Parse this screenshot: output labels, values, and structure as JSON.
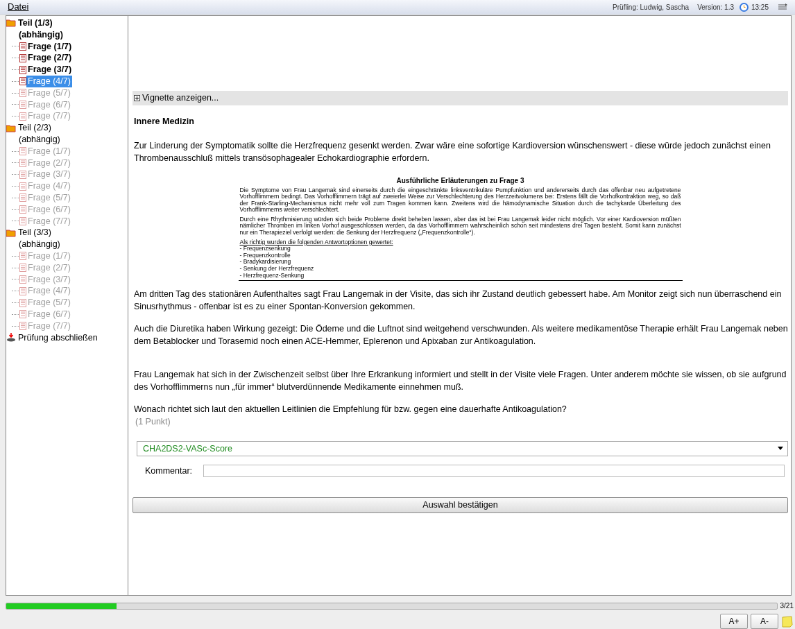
{
  "menu": [
    "Datei"
  ],
  "status": {
    "candidate": "Prüfling: Ludwig, Sascha",
    "version": "Version: 1.3",
    "time": "13:25"
  },
  "tree": [
    {
      "label": "Teil (1/3)",
      "sublabel": "(abhängig)",
      "children": [
        {
          "label": "Frage (1/7)",
          "answered": true,
          "disabled": false,
          "selected": false
        },
        {
          "label": "Frage (2/7)",
          "answered": true,
          "disabled": false,
          "selected": false
        },
        {
          "label": "Frage (3/7)",
          "answered": true,
          "disabled": false,
          "selected": false
        },
        {
          "label": "Frage (4/7)",
          "answered": false,
          "disabled": false,
          "selected": true
        },
        {
          "label": "Frage (5/7)",
          "answered": false,
          "disabled": true,
          "selected": false
        },
        {
          "label": "Frage (6/7)",
          "answered": false,
          "disabled": true,
          "selected": false
        },
        {
          "label": "Frage (7/7)",
          "answered": false,
          "disabled": true,
          "selected": false
        }
      ]
    },
    {
      "label": "Teil (2/3)",
      "sublabel": "(abhängig)",
      "children": [
        {
          "label": "Frage (1/7)",
          "answered": false,
          "disabled": true,
          "selected": false
        },
        {
          "label": "Frage (2/7)",
          "answered": false,
          "disabled": true,
          "selected": false
        },
        {
          "label": "Frage (3/7)",
          "answered": false,
          "disabled": true,
          "selected": false
        },
        {
          "label": "Frage (4/7)",
          "answered": false,
          "disabled": true,
          "selected": false
        },
        {
          "label": "Frage (5/7)",
          "answered": false,
          "disabled": true,
          "selected": false
        },
        {
          "label": "Frage (6/7)",
          "answered": false,
          "disabled": true,
          "selected": false
        },
        {
          "label": "Frage (7/7)",
          "answered": false,
          "disabled": true,
          "selected": false
        }
      ]
    },
    {
      "label": "Teil (3/3)",
      "sublabel": "(abhängig)",
      "children": [
        {
          "label": "Frage (1/7)",
          "answered": false,
          "disabled": true,
          "selected": false
        },
        {
          "label": "Frage (2/7)",
          "answered": false,
          "disabled": true,
          "selected": false
        },
        {
          "label": "Frage (3/7)",
          "answered": false,
          "disabled": true,
          "selected": false
        },
        {
          "label": "Frage (4/7)",
          "answered": false,
          "disabled": true,
          "selected": false
        },
        {
          "label": "Frage (5/7)",
          "answered": false,
          "disabled": true,
          "selected": false
        },
        {
          "label": "Frage (6/7)",
          "answered": false,
          "disabled": true,
          "selected": false
        },
        {
          "label": "Frage (7/7)",
          "answered": false,
          "disabled": true,
          "selected": false
        }
      ]
    }
  ],
  "finish": "Prüfung abschließen",
  "vignette": {
    "label": "Vignette anzeigen...",
    "expanded": false
  },
  "subject": "Innere Medizin",
  "paragraphs_before": [
    "Zur Linderung der Symptomatik sollte die Herzfrequenz gesenkt werden. Zwar wäre eine sofortige Kardioversion wünschenswert - diese würde jedoch zunächst einen Thrombenausschluß mittels transösophagealer Echokardiographie erfordern."
  ],
  "document": {
    "title": "Ausführliche Erläuterungen zu Frage 3",
    "paragraphs": [
      "Die Symptome von Frau Langemak sind einerseits durch die eingeschränkte linksventrikuläre Pumpfunktion und andererseits durch das offenbar neu aufgetretene Vorhofflimmern bedingt. Das Vorhofflimmern trägt auf zweierlei Weise zur Verschlechterung des Herzzeitvolumens bei: Erstens fällt die Vorhofkontraktion weg, so daß der Frank-Starling-Mechanismus nicht mehr voll zum Tragen kommen kann. Zweitens wird die hämodynamische Situation durch die tachykarde Überleitung des Vorhofflimmerns weiter verschlechtert.",
      "Durch eine Rhythmisierung würden sich beide Probleme direkt beheben lassen, aber das ist bei Frau Langemak leider nicht möglich. Vor einer Kardioversion müßten nämlicher Thromben im linken Vorhof ausgeschlossen werden, da das Vorhofflimmern wahrscheinlich schon seit mindestens drei Tagen besteht. Somit kann zunächst nur ein Therapieziel verfolgt werden: die Senkung der Herzfrequenz („Frequenzkontrolle“)."
    ],
    "list_heading": "Als richtig wurden die folgenden Antwortoptionen gewertet:",
    "list": [
      "- Frequenzsenkung",
      "- Frequenzkontrolle",
      "- Bradykardisierung",
      "- Senkung der Herzfrequenz",
      "- Herzfrequenz-Senkung"
    ]
  },
  "paragraphs_after": [
    "Am dritten Tag des stationären Aufenthaltes sagt Frau Langemak in der Visite, das sich ihr Zustand deutlich gebessert habe. Am Monitor zeigt sich nun überraschend ein Sinusrhythmus - offenbar ist es zu einer Spontan-Konversion gekommen.",
    "Auch die Diuretika haben Wirkung gezeigt: Die Ödeme und die Luftnot sind weitgehend verschwunden. Als weitere medikamentöse Therapie erhält Frau Langemak neben dem Betablocker und Torasemid noch einen ACE-Hemmer, Eplerenon und Apixaban zur Antikoagulation.",
    "Frau Langemak hat sich in der Zwischenzeit selbst über Ihre Erkrankung informiert und stellt in der Visite viele Fragen. Unter anderem möchte sie wissen, ob sie aufgrund des Vorhofflimmerns nun „für immer“ blutverdünnende Medikamente einnehmen muß."
  ],
  "question": "Wonach richtet sich laut den aktuellen Leitlinien die Empfehlung für bzw. gegen eine dauerhafte Antikoagulation?",
  "points": "(1 Punkt)",
  "answer": {
    "value": "CHA2DS2-VASc-Score"
  },
  "comment": {
    "label": "Kommentar:"
  },
  "confirm": "Auswahl bestätigen",
  "progress": {
    "level": 0.143,
    "reading": "3/21"
  },
  "font_buttons": [
    "A+",
    "A-"
  ]
}
